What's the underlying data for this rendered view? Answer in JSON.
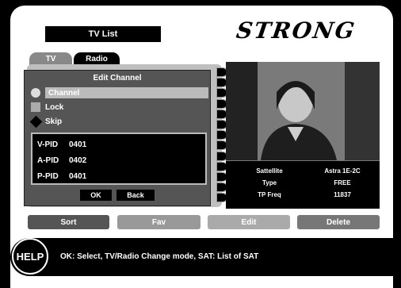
{
  "header": {
    "title": "TV List",
    "brand": "STRONG"
  },
  "tabs": [
    {
      "label": "TV"
    },
    {
      "label": "Radio"
    }
  ],
  "dialog": {
    "title": "Edit Channel",
    "options": [
      {
        "label": "Channel",
        "icon": "circle-icon"
      },
      {
        "label": "Lock",
        "icon": "square-icon"
      },
      {
        "label": "Skip",
        "icon": "diamond-icon"
      }
    ],
    "pids": [
      {
        "label": "V-PID",
        "value": "0401"
      },
      {
        "label": "A-PID",
        "value": "0402"
      },
      {
        "label": "P-PID",
        "value": "0401"
      }
    ],
    "ok_label": "OK",
    "back_label": "Back"
  },
  "info": {
    "rows": [
      {
        "key": "Sattellite",
        "value": "Astra 1E-2C"
      },
      {
        "key": "Type",
        "value": "FREE"
      },
      {
        "key": "TP Freq",
        "value": "11837"
      }
    ]
  },
  "actions": {
    "sort": "Sort",
    "fav": "Fav",
    "edit": "Edit",
    "delete": "Delete"
  },
  "help": {
    "badge": "HELP",
    "text": "OK: Select, TV/Radio Change mode, SAT: List of SAT"
  }
}
